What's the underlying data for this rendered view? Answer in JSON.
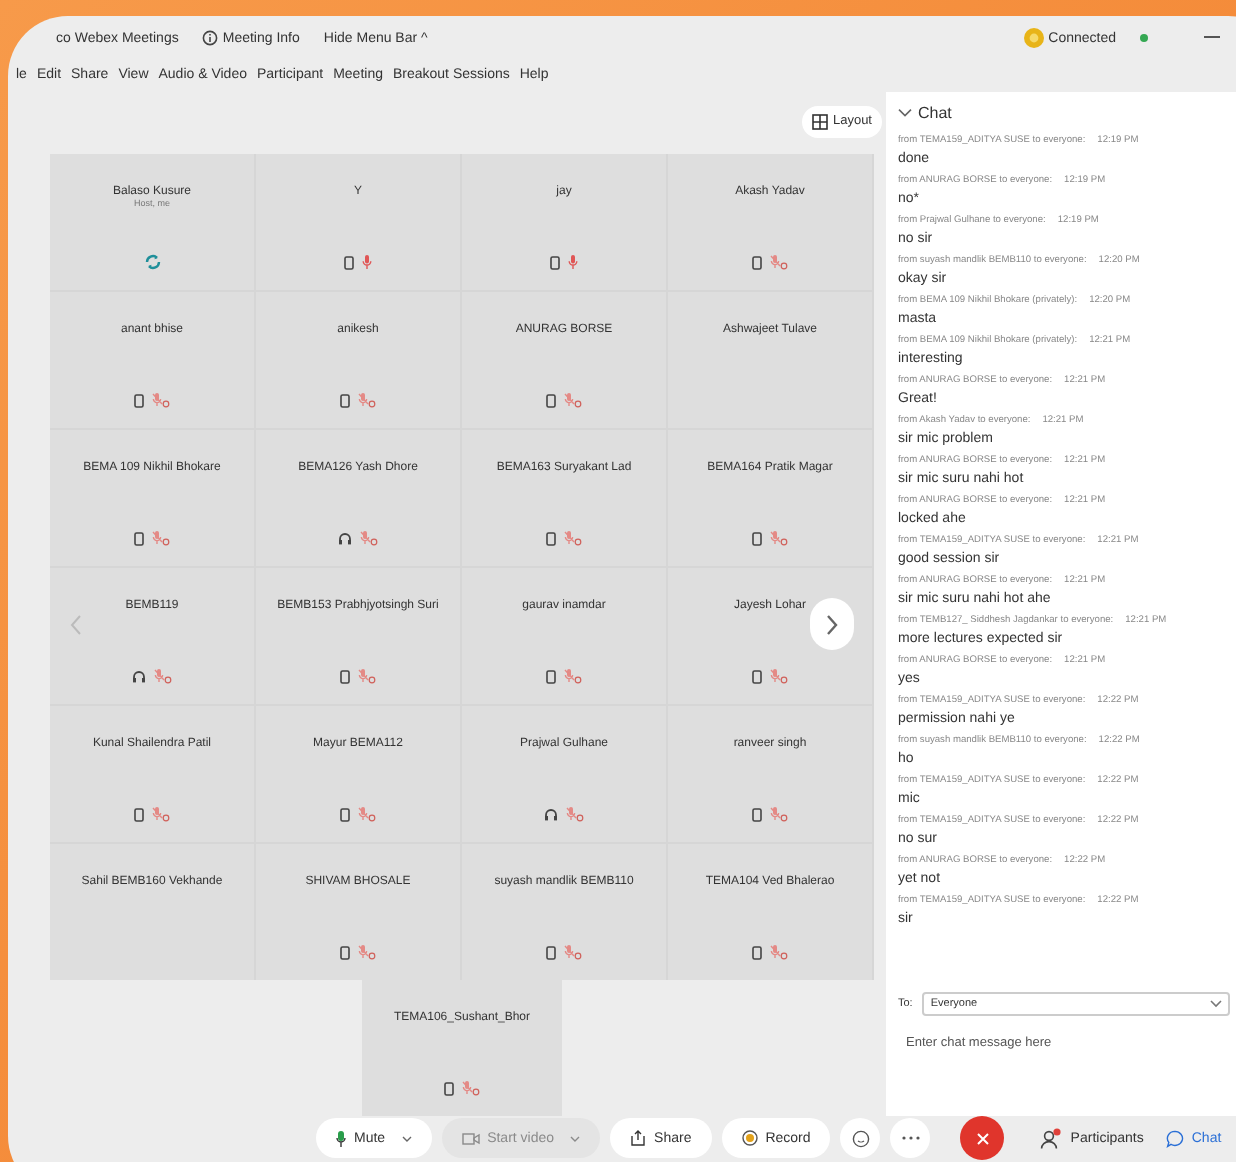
{
  "title_bar": {
    "app_title": "co Webex Meetings",
    "meeting_info": "Meeting Info",
    "hide_menu": "Hide Menu Bar ^",
    "status": "Connected"
  },
  "menu": [
    "le",
    "Edit",
    "Share",
    "View",
    "Audio & Video",
    "Participant",
    "Meeting",
    "Breakout Sessions",
    "Help"
  ],
  "layout_button": "Layout",
  "tiles": [
    {
      "name": "Balaso Kusure",
      "subtitle": "Host, me",
      "kind": "sync",
      "mic_live": false,
      "mic_muted": false
    },
    {
      "name": "Y",
      "kind": "phone",
      "mic_live": true,
      "mic_muted": false
    },
    {
      "name": "jay",
      "kind": "phone",
      "mic_live": true,
      "mic_muted": false
    },
    {
      "name": "Akash Yadav",
      "kind": "phone",
      "mic_live": false,
      "mic_muted": true
    },
    {
      "name": "anant bhise",
      "kind": "phone",
      "mic_live": false,
      "mic_muted": true
    },
    {
      "name": "anikesh",
      "kind": "phone",
      "mic_live": false,
      "mic_muted": true
    },
    {
      "name": "ANURAG BORSE",
      "kind": "phone",
      "mic_live": false,
      "mic_muted": true
    },
    {
      "name": "Ashwajeet Tulave",
      "kind": "blank",
      "mic_live": false,
      "mic_muted": false
    },
    {
      "name": "BEMA 109 Nikhil Bhokare",
      "kind": "phone",
      "mic_live": false,
      "mic_muted": true
    },
    {
      "name": "BEMA126 Yash Dhore",
      "kind": "headset",
      "mic_live": false,
      "mic_muted": true
    },
    {
      "name": "BEMA163 Suryakant Lad",
      "kind": "phone",
      "mic_live": false,
      "mic_muted": true
    },
    {
      "name": "BEMA164 Pratik Magar",
      "kind": "phone",
      "mic_live": false,
      "mic_muted": true
    },
    {
      "name": "BEMB119",
      "kind": "headset",
      "mic_live": false,
      "mic_muted": true
    },
    {
      "name": "BEMB153 Prabhjyotsingh Suri",
      "kind": "phone",
      "mic_live": false,
      "mic_muted": true
    },
    {
      "name": "gaurav inamdar",
      "kind": "phone",
      "mic_live": false,
      "mic_muted": true
    },
    {
      "name": "Jayesh Lohar",
      "kind": "phone",
      "mic_live": false,
      "mic_muted": true
    },
    {
      "name": "Kunal Shailendra Patil",
      "kind": "phone",
      "mic_live": false,
      "mic_muted": true
    },
    {
      "name": "Mayur BEMA112",
      "kind": "phone",
      "mic_live": false,
      "mic_muted": true
    },
    {
      "name": "Prajwal Gulhane",
      "kind": "headset",
      "mic_live": false,
      "mic_muted": true
    },
    {
      "name": "ranveer singh",
      "kind": "phone",
      "mic_live": false,
      "mic_muted": true
    },
    {
      "name": "Sahil BEMB160 Vekhande",
      "kind": "blank",
      "mic_live": false,
      "mic_muted": false
    },
    {
      "name": "SHIVAM BHOSALE",
      "kind": "phone",
      "mic_live": false,
      "mic_muted": true
    },
    {
      "name": "suyash mandlik BEMB110",
      "kind": "phone",
      "mic_live": false,
      "mic_muted": true
    },
    {
      "name": "TEMA104 Ved Bhalerao",
      "kind": "phone",
      "mic_live": false,
      "mic_muted": true
    },
    {
      "name": "TEMA106_Sushant_Bhor",
      "kind": "phone",
      "mic_live": false,
      "mic_muted": true
    }
  ],
  "chat": {
    "title": "Chat",
    "messages": [
      {
        "from": "from TEMA159_ADITYA SUSE to everyone:",
        "time": "12:19 PM",
        "text": "done"
      },
      {
        "from": "from ANURAG BORSE to everyone:",
        "time": "12:19 PM",
        "text": "no*"
      },
      {
        "from": "from Prajwal Gulhane to everyone:",
        "time": "12:19 PM",
        "text": "no sir"
      },
      {
        "from": "from suyash mandlik BEMB110 to everyone:",
        "time": "12:20 PM",
        "text": "okay sir"
      },
      {
        "from": "from BEMA 109 Nikhil Bhokare (privately):",
        "time": "12:20 PM",
        "text": "masta"
      },
      {
        "from": "from BEMA 109 Nikhil Bhokare (privately):",
        "time": "12:21 PM",
        "text": "interesting"
      },
      {
        "from": "from ANURAG BORSE to everyone:",
        "time": "12:21 PM",
        "text": "Great!"
      },
      {
        "from": "from Akash Yadav to everyone:",
        "time": "12:21 PM",
        "text": "sir mic problem"
      },
      {
        "from": "from ANURAG BORSE to everyone:",
        "time": "12:21 PM",
        "text": "sir mic suru nahi hot"
      },
      {
        "from": "from ANURAG BORSE to everyone:",
        "time": "12:21 PM",
        "text": "locked ahe"
      },
      {
        "from": "from TEMA159_ADITYA SUSE to everyone:",
        "time": "12:21 PM",
        "text": "good session sir"
      },
      {
        "from": "from ANURAG BORSE to everyone:",
        "time": "12:21 PM",
        "text": "sir mic suru nahi hot ahe"
      },
      {
        "from": "from TEMB127_ Siddhesh Jagdankar to everyone:",
        "time": "12:21 PM",
        "text": "more lectures expected sir"
      },
      {
        "from": "from ANURAG BORSE to everyone:",
        "time": "12:21 PM",
        "text": "yes"
      },
      {
        "from": "from TEMA159_ADITYA SUSE to everyone:",
        "time": "12:22 PM",
        "text": "permission nahi ye"
      },
      {
        "from": "from suyash mandlik BEMB110 to everyone:",
        "time": "12:22 PM",
        "text": "ho"
      },
      {
        "from": "from TEMA159_ADITYA SUSE to everyone:",
        "time": "12:22 PM",
        "text": "mic"
      },
      {
        "from": "from TEMA159_ADITYA SUSE to everyone:",
        "time": "12:22 PM",
        "text": "no sur"
      },
      {
        "from": "from ANURAG BORSE to everyone:",
        "time": "12:22 PM",
        "text": "yet not"
      },
      {
        "from": "from TEMA159_ADITYA SUSE to everyone:",
        "time": "12:22 PM",
        "text": "sir"
      }
    ],
    "to_label": "To:",
    "recipient": "Everyone",
    "placeholder": "Enter chat message here"
  },
  "toolbar": {
    "mute": "Mute",
    "start_video": "Start video",
    "video_disabled": true,
    "share": "Share",
    "record": "Record",
    "participants": "Participants",
    "chat": "Chat",
    "participants_alert": true
  }
}
